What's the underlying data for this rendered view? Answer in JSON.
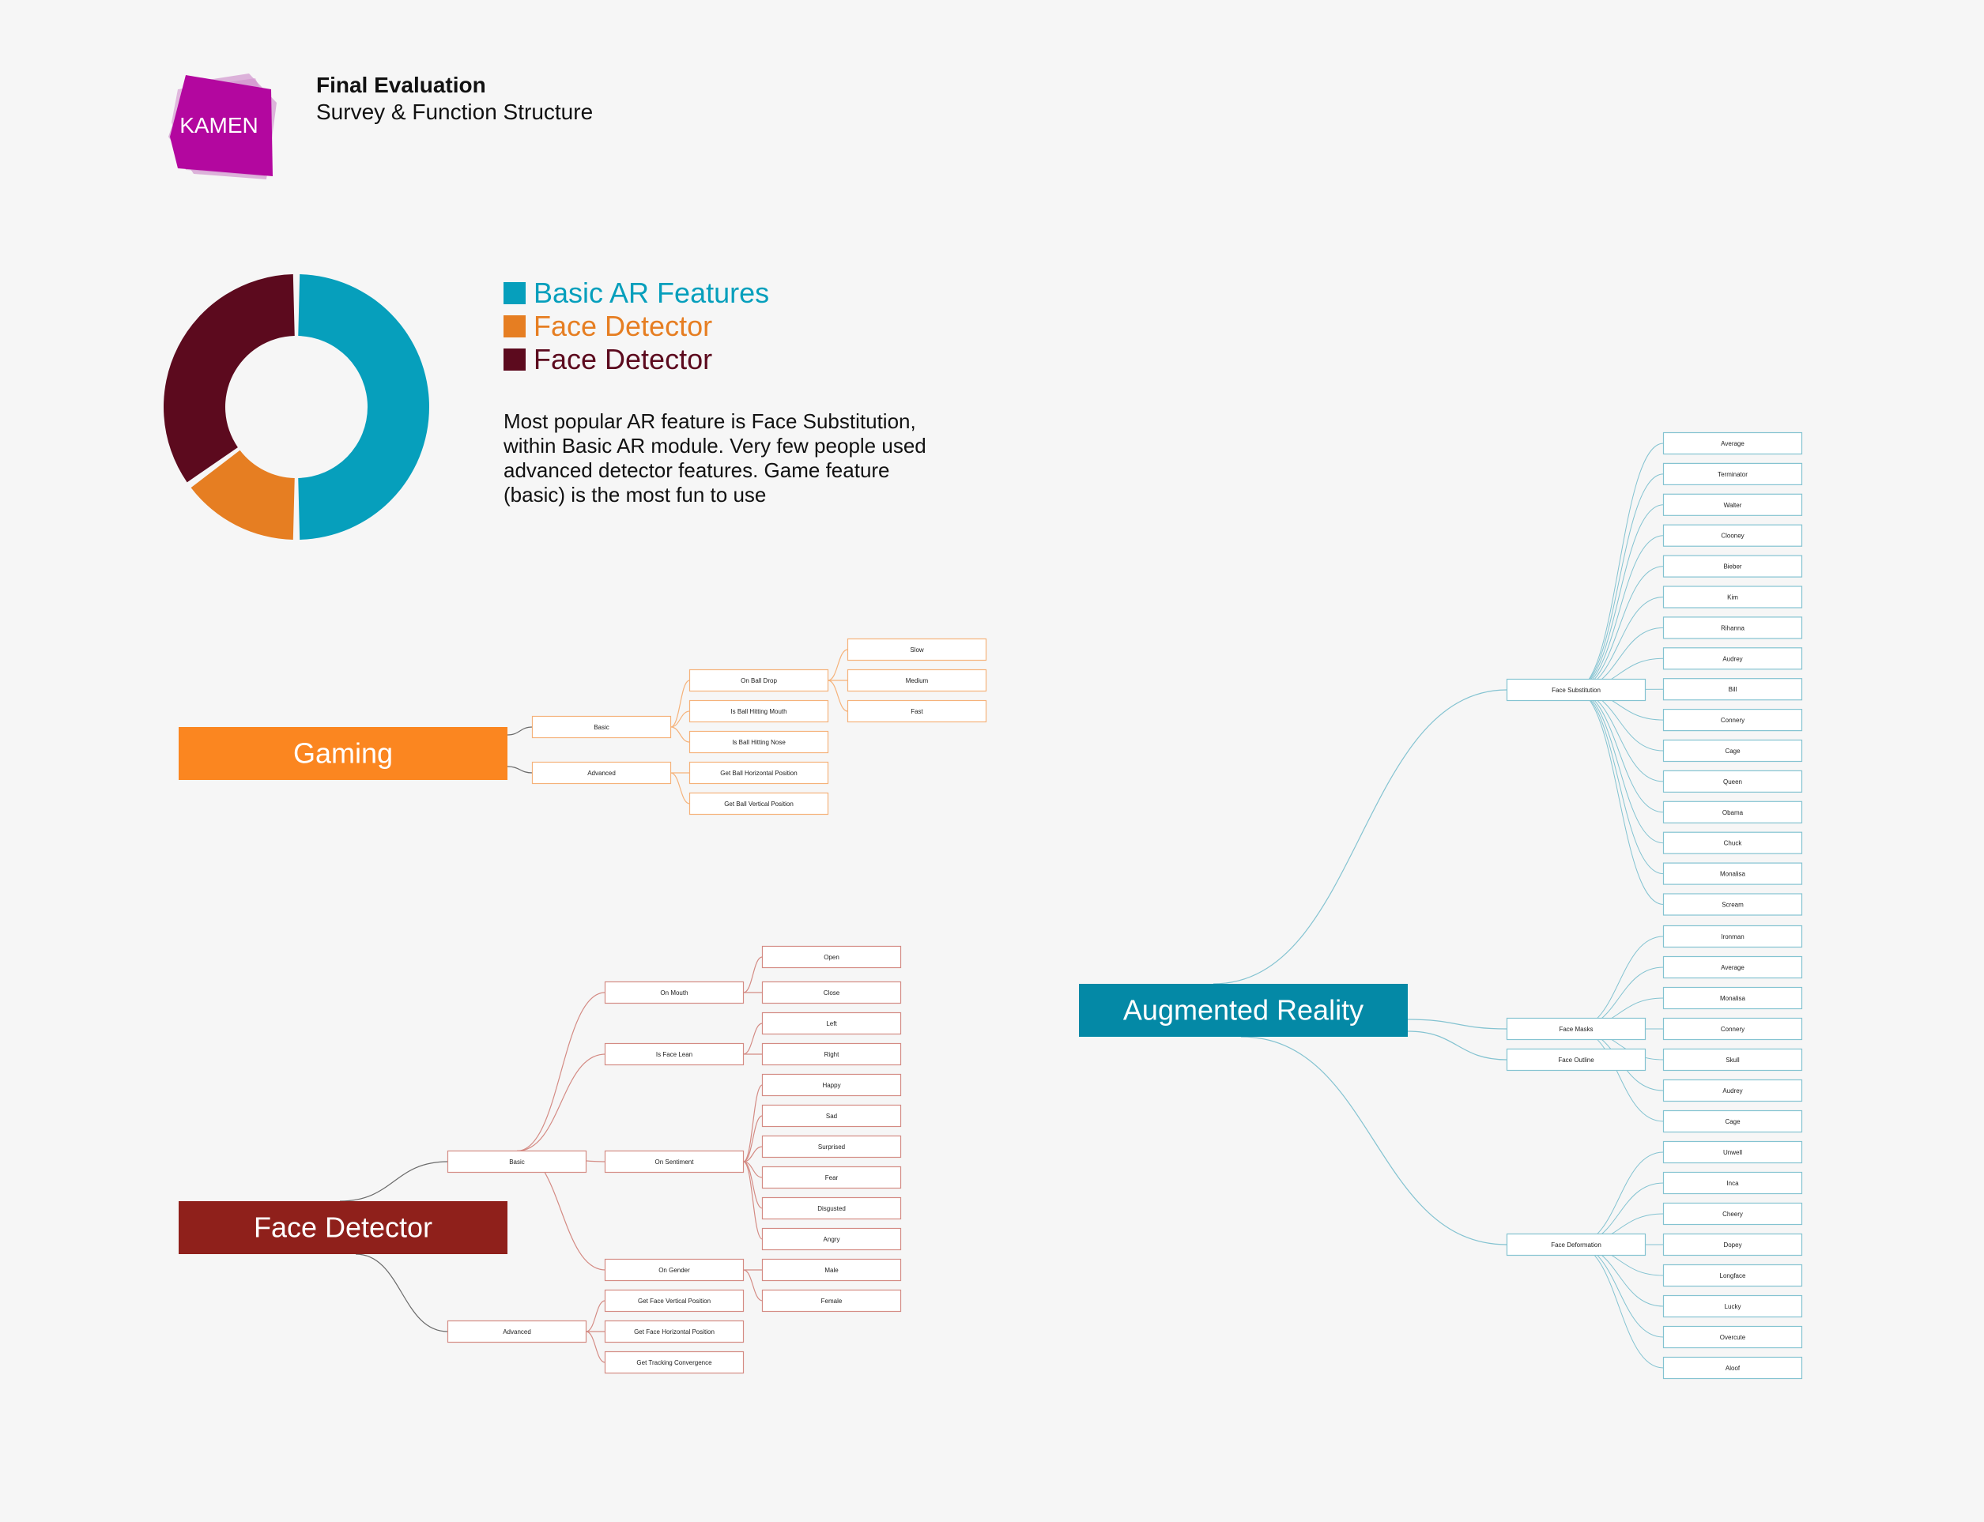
{
  "header": {
    "logo_text": "KAMEN",
    "title": "Final Evaluation",
    "subtitle": "Survey & Function Structure"
  },
  "legend": [
    {
      "label": "Basic AR Features",
      "color": "#069fbc"
    },
    {
      "label": "Face Detector",
      "color": "#e67e22"
    },
    {
      "label": "Face Detector",
      "color": "#5c0a1e"
    }
  ],
  "note": "Most popular AR feature is Face Substitution, within Basic AR module. Very few people used advanced detector features. Game feature (basic) is the most fun to use",
  "chart_data": {
    "type": "pie",
    "donut": true,
    "slices": [
      {
        "label": "Basic AR Features",
        "value": 50,
        "color": "#069fbc"
      },
      {
        "label": "Face Detector",
        "value": 15,
        "color": "#e67e22"
      },
      {
        "label": "Face Detector",
        "value": 35,
        "color": "#5c0a1e"
      }
    ]
  },
  "mindmaps": {
    "gaming": {
      "label": "Gaming",
      "color": "#fb8620",
      "children": [
        {
          "label": "Basic",
          "children": [
            {
              "label": "On Ball Drop",
              "children": [
                {
                  "label": "Slow"
                },
                {
                  "label": "Medium"
                },
                {
                  "label": "Fast"
                }
              ]
            },
            {
              "label": "Is Ball Hitting Mouth"
            },
            {
              "label": "Is Ball Hitting Nose"
            }
          ]
        },
        {
          "label": "Advanced",
          "children": [
            {
              "label": "Get Ball Horizontal Position"
            },
            {
              "label": "Get Ball Vertical Position"
            }
          ]
        }
      ]
    },
    "face_detector": {
      "label": "Face Detector",
      "color": "#8f201b",
      "children": [
        {
          "label": "Basic",
          "children": [
            {
              "label": "On Mouth",
              "children": [
                {
                  "label": "Open"
                },
                {
                  "label": "Close"
                }
              ]
            },
            {
              "label": "Is Face Lean",
              "children": [
                {
                  "label": "Left"
                },
                {
                  "label": "Right"
                }
              ]
            },
            {
              "label": "On Sentiment",
              "children": [
                {
                  "label": "Happy"
                },
                {
                  "label": "Sad"
                },
                {
                  "label": "Surprised"
                },
                {
                  "label": "Fear"
                },
                {
                  "label": "Disgusted"
                },
                {
                  "label": "Angry"
                }
              ]
            },
            {
              "label": "On Gender",
              "children": [
                {
                  "label": "Male"
                },
                {
                  "label": "Female"
                }
              ]
            }
          ]
        },
        {
          "label": "Advanced",
          "children": [
            {
              "label": "Get Face Vertical Position"
            },
            {
              "label": "Get Face Horizontal Position"
            },
            {
              "label": "Get Tracking Convergence"
            }
          ]
        }
      ]
    },
    "augmented_reality": {
      "label": "Augmented Reality",
      "color": "#0489a6",
      "children": [
        {
          "label": "Face Substitution",
          "children": [
            {
              "label": "Average"
            },
            {
              "label": "Terminator"
            },
            {
              "label": "Walter"
            },
            {
              "label": "Clooney"
            },
            {
              "label": "Bieber"
            },
            {
              "label": "Kim"
            },
            {
              "label": "Rihanna"
            },
            {
              "label": "Audrey"
            },
            {
              "label": "Bill"
            },
            {
              "label": "Connery"
            },
            {
              "label": "Cage"
            },
            {
              "label": "Queen"
            },
            {
              "label": "Obama"
            },
            {
              "label": "Chuck"
            },
            {
              "label": "Monalisa"
            },
            {
              "label": "Scream"
            }
          ]
        },
        {
          "label": "Face Masks",
          "children": [
            {
              "label": "Ironman"
            },
            {
              "label": "Average"
            },
            {
              "label": "Monalisa"
            },
            {
              "label": "Connery"
            },
            {
              "label": "Skull"
            },
            {
              "label": "Audrey"
            },
            {
              "label": "Cage"
            }
          ]
        },
        {
          "label": "Face Outline"
        },
        {
          "label": "Face Deformation",
          "children": [
            {
              "label": "Unwell"
            },
            {
              "label": "Inca"
            },
            {
              "label": "Cheery"
            },
            {
              "label": "Dopey"
            },
            {
              "label": "Longface"
            },
            {
              "label": "Lucky"
            },
            {
              "label": "Overcute"
            },
            {
              "label": "Aloof"
            }
          ]
        }
      ]
    }
  }
}
